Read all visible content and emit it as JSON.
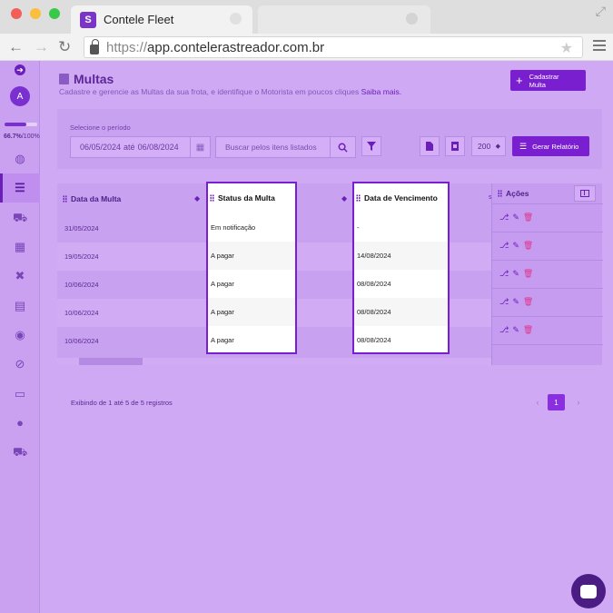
{
  "browser": {
    "tab_title": "Contele Fleet",
    "url_protocol": "https://",
    "url_host": "app.contelerastreador.com.br"
  },
  "sidebar": {
    "avatar_initial": "A",
    "progress_value": "66.7%",
    "progress_max": "/100%",
    "progress_fraction": 0.667,
    "icons": [
      "arrow-right-icon",
      "globe-icon",
      "list-icon",
      "car-icon",
      "grid-icon",
      "tools-icon",
      "document-icon",
      "circle-icon",
      "ban-icon",
      "card-icon",
      "user-icon",
      "car2-icon"
    ]
  },
  "header": {
    "title": "Multas",
    "subtitle": "Cadastre e gerencie as Multas da sua frota, e identifique o Motorista em poucos cliques",
    "link": "Saiba mais.",
    "add_button": "Cadastrar Multa"
  },
  "filters": {
    "period_label": "Selecione o período",
    "date_from": "06/05/2024",
    "date_sep": "até",
    "date_to": "06/08/2024",
    "search_placeholder": "Buscar pelos itens listados",
    "page_size": "200",
    "report_button": "Gerar Relatório"
  },
  "table": {
    "columns": [
      "Data da Multa",
      "Status da Multa",
      "Data de Vencimento",
      "Ações"
    ],
    "rows": [
      {
        "data": "31/05/2024",
        "status": "Em notificação",
        "vencimento": "-"
      },
      {
        "data": "19/05/2024",
        "status": "A pagar",
        "vencimento": "14/08/2024"
      },
      {
        "data": "10/06/2024",
        "status": "A pagar",
        "vencimento": "08/08/2024"
      },
      {
        "data": "10/06/2024",
        "status": "A pagar",
        "vencimento": "08/08/2024"
      },
      {
        "data": "10/06/2024",
        "status": "A pagar",
        "vencimento": "08/08/2024"
      }
    ]
  },
  "footer": {
    "info": "Exibindo de 1 até 5 de 5 registros",
    "current_page": "1"
  },
  "colors": {
    "accent": "#7a1fd0",
    "background": "#d0a9f5",
    "delete": "#e0348c"
  }
}
